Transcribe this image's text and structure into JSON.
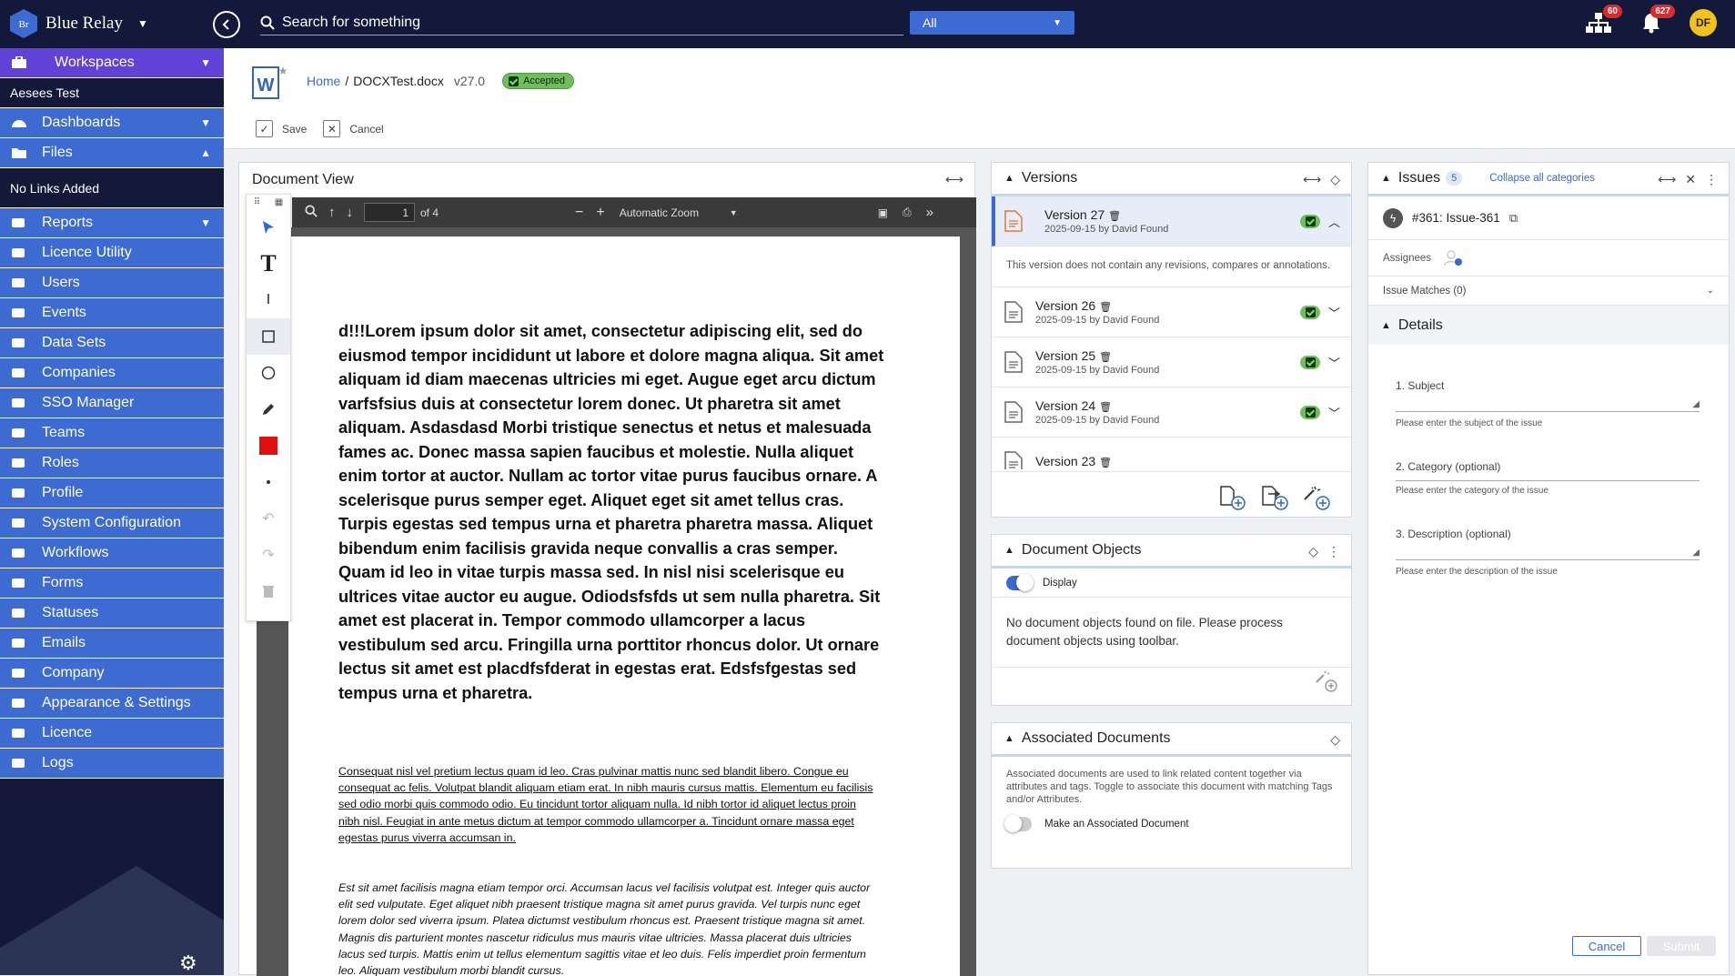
{
  "app": {
    "name": "Blue Relay",
    "logo_text": "Br",
    "search_placeholder": "Search for something",
    "scope": "All",
    "notifications": {
      "org_badge": "60",
      "bell_badge": "627"
    },
    "user_initials": "DF"
  },
  "sidebar": {
    "workspaces": "Workspaces",
    "workspace_current": "Aesees Test",
    "dashboards": "Dashboards",
    "files": "Files",
    "files_empty": "No Links Added",
    "items": [
      "Reports",
      "Licence Utility",
      "Users",
      "Events",
      "Data Sets",
      "Companies",
      "SSO Manager",
      "Teams",
      "Roles",
      "Profile",
      "System Configuration",
      "Workflows",
      "Forms",
      "Statuses",
      "Emails",
      "Company",
      "Appearance & Settings",
      "Licence",
      "Logs"
    ]
  },
  "header": {
    "home": "Home",
    "file": "DOCXTest.docx",
    "version": "v27.0",
    "status": "Accepted",
    "save": "Save",
    "cancel": "Cancel"
  },
  "docview": {
    "title": "Document View",
    "page_num": "1",
    "page_of": "of 4",
    "zoom": "Automatic Zoom",
    "para_bold": "d!!!Lorem ipsum dolor sit amet, consectetur adipiscing elit, sed do eiusmod tempor incididunt ut labore et dolore magna aliqua. Sit amet aliquam id diam maecenas ultricies mi eget. Augue eget arcu dictum varfsfsius duis at consectetur lorem donec. Ut pharetra sit amet aliquam. Asdasdasd Morbi tristique senectus et netus et malesuada fames ac. Donec massa sapien faucibus et molestie. Nulla aliquet enim tortor at auctor. Nullam ac tortor vitae purus faucibus ornare. A scelerisque purus semper eget. Aliquet eget sit amet tellus cras. Turpis egestas sed tempus urna et pharetra pharetra massa. Aliquet bibendum enim facilisis gravida neque convallis a cras semper. Quam id leo in vitae turpis massa sed. In nisl nisi scelerisque eu ultrices vitae auctor eu augue. Odiodsfsfds ut sem nulla pharetra. Sit amet est placerat in. Tempor commodo ullamcorper a lacus vestibulum sed arcu. Fringilla urna porttitor rhoncus dolor. Ut ornare lectus sit amet est placdfsfderat in egestas erat. Edsfsfgestas sed tempus urna et pharetra.",
    "para_underline": "Consequat nisl vel pretium lectus quam id leo. Cras pulvinar mattis nunc sed blandit libero. Congue eu consequat ac felis. Volutpat blandit aliquam etiam erat. In nibh mauris cursus mattis. Elementum eu facilisis sed odio morbi quis commodo odio. Eu tincidunt tortor aliquam nulla. Id nibh tortor id aliquet lectus proin nibh nisl. Feugiat in ante metus dictum at tempor commodo ullamcorper a. Tincidunt ornare massa eget egestas purus viverra accumsan in.",
    "para_italic": "Est sit amet facilisis magna etiam tempor orci. Accumsan lacus vel facilisis volutpat est. Integer quis auctor elit sed vulputate. Eget aliquet nibh praesent tristique magna sit amet purus gravida. Vel turpis nunc eget lorem dolor sed viverra ipsum. Platea dictumst vestibulum rhoncus est. Praesent tristique magna sit amet. Magnis dis parturient montes nascetur ridiculus mus mauris vitae ultricies. Massa placerat duis ultricies lacus sed turpis. Mattis enim ut tellus elementum sagittis vitae et leo duis. Felis imperdiet proin fermentum leo. Aliquam vestibulum morbi blandit cursus."
  },
  "versions": {
    "title": "Versions",
    "note": "This version does not contain any revisions, compares or annotations.",
    "items": [
      {
        "name": "Version 27",
        "meta": "2025-09-15 by David Found"
      },
      {
        "name": "Version 26",
        "meta": "2025-09-15 by David Found"
      },
      {
        "name": "Version 25",
        "meta": "2025-09-15 by David Found"
      },
      {
        "name": "Version 24",
        "meta": "2025-09-15 by David Found"
      },
      {
        "name": "Version 23",
        "meta": ""
      }
    ]
  },
  "docobjects": {
    "title": "Document Objects",
    "toggle_label": "Display",
    "empty": "No document objects found on file. Please process document objects using toolbar."
  },
  "assoc": {
    "title": "Associated Documents",
    "desc": "Associated documents are used to link related content together via attributes and tags. Toggle to associate this document with matching Tags and/or Attributes.",
    "toggle_label": "Make an Associated Document"
  },
  "issues": {
    "title": "Issues",
    "count": "5",
    "collapse": "Collapse all categories",
    "issue_id": "#361: Issue-361",
    "assignees": "Assignees",
    "matches": "Issue Matches (0)",
    "details": "Details",
    "subject_label": "1. Subject",
    "subject_hint": "Please enter the subject of the issue",
    "category_label": "2. Category  (optional)",
    "category_hint": "Please enter the category of the issue",
    "description_label": "3. Description  (optional)",
    "description_hint": "Please enter the description of the issue",
    "cancel": "Cancel",
    "submit": "Submit"
  },
  "colors": {
    "accent": "#3e6bd1",
    "sidebar": "#14193a",
    "workspaces": "#6142d9",
    "status_green": "#6fbe5b"
  }
}
